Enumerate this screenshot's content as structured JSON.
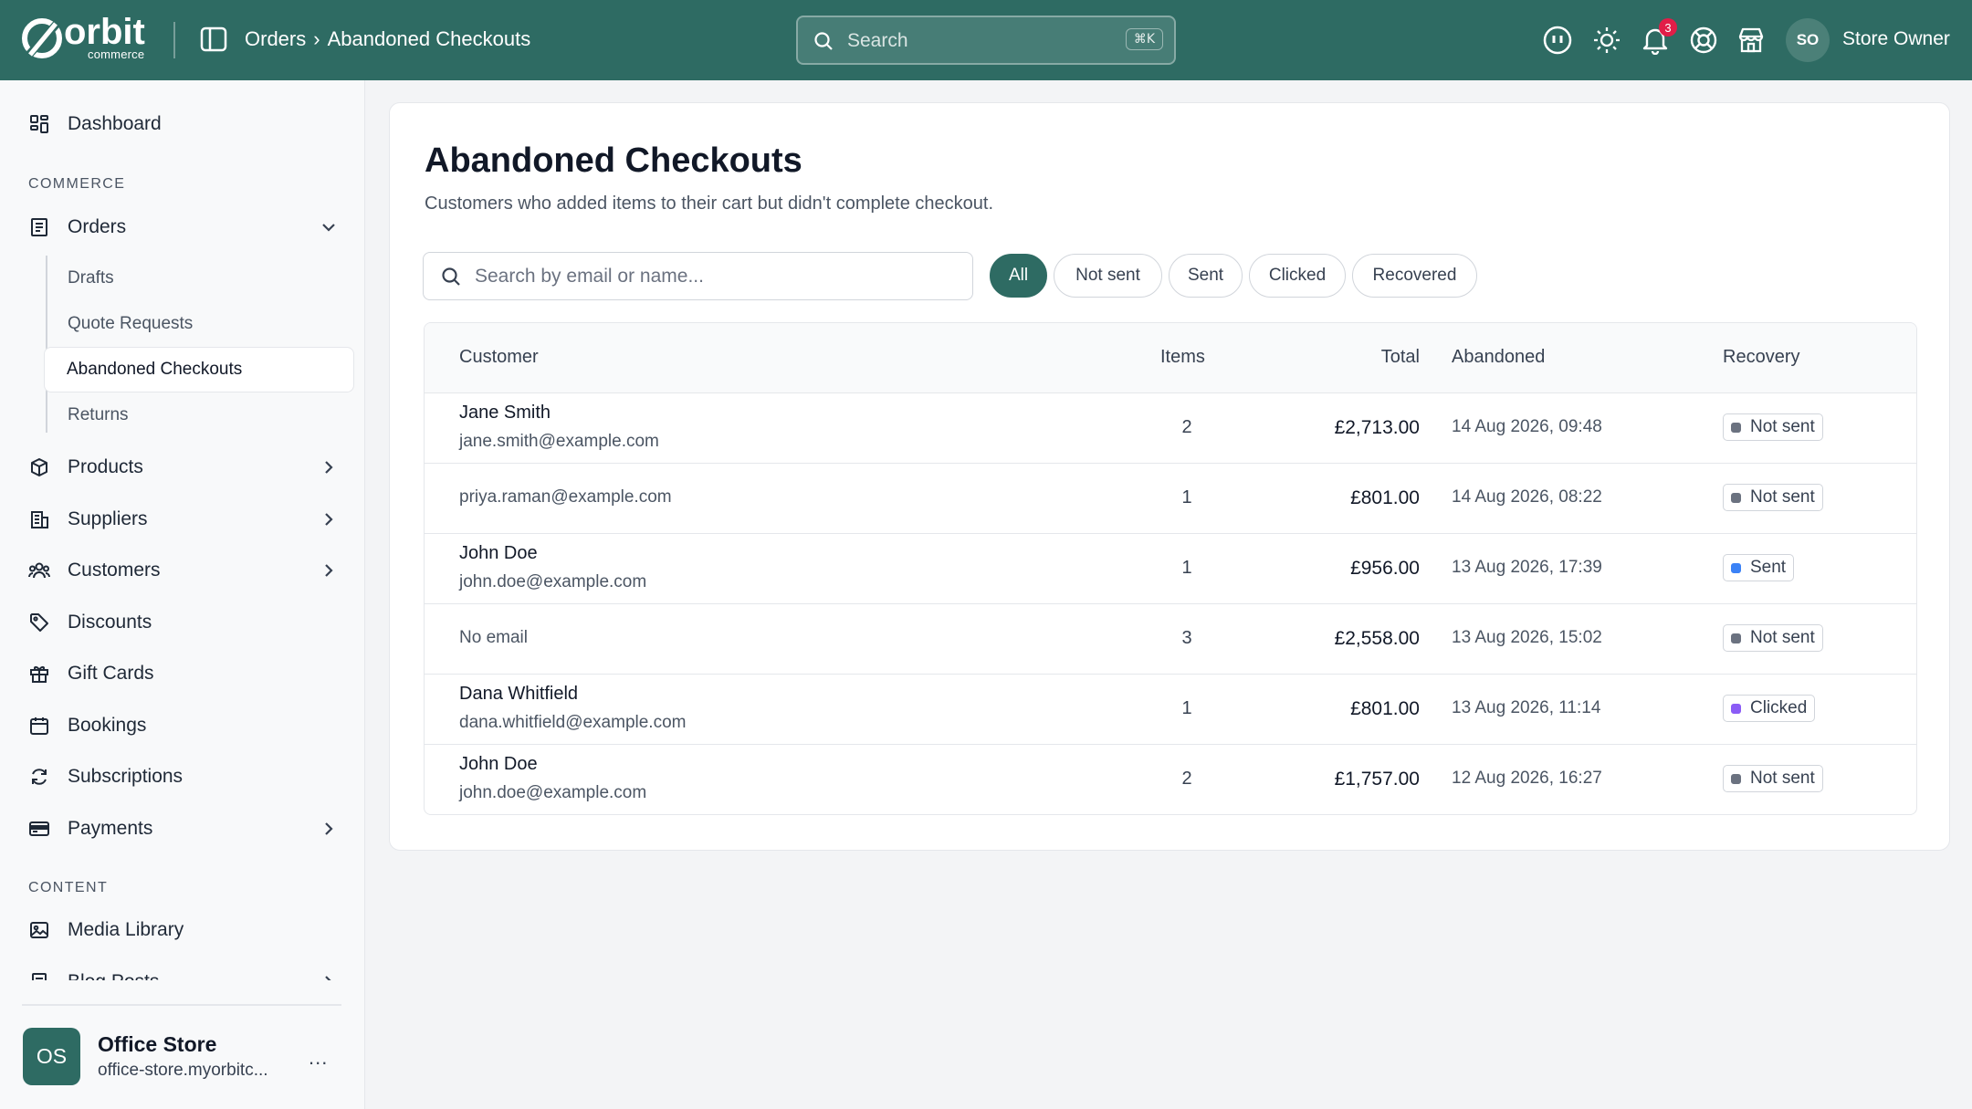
{
  "header": {
    "logo_text": "orbit",
    "logo_sub": "commerce",
    "breadcrumb": [
      "Orders",
      "›",
      "Abandoned Checkouts"
    ],
    "search_placeholder": "Search",
    "search_shortcut": "⌘K",
    "notification_count": "3",
    "avatar_initials": "SO",
    "user_name": "Store Owner"
  },
  "sidebar": {
    "dashboard": "Dashboard",
    "section_commerce": "COMMERCE",
    "orders": "Orders",
    "orders_sub": [
      "Drafts",
      "Quote Requests",
      "Abandoned Checkouts",
      "Returns"
    ],
    "products": "Products",
    "suppliers": "Suppliers",
    "customers": "Customers",
    "discounts": "Discounts",
    "gift_cards": "Gift Cards",
    "bookings": "Bookings",
    "subscriptions": "Subscriptions",
    "payments": "Payments",
    "section_content": "CONTENT",
    "media_library": "Media Library",
    "blog_posts": "Blog Posts",
    "store": {
      "initials": "OS",
      "name": "Office Store",
      "url": "office-store.myorbitc...",
      "more": "..."
    }
  },
  "main": {
    "title": "Abandoned Checkouts",
    "subtitle": "Customers who added items to their cart but didn't complete checkout.",
    "search_placeholder": "Search by email or name...",
    "filters": [
      "All",
      "Not sent",
      "Sent",
      "Clicked",
      "Recovered"
    ],
    "active_filter": "All",
    "columns": {
      "customer": "Customer",
      "items": "Items",
      "total": "Total",
      "abandoned": "Abandoned",
      "recovery": "Recovery"
    },
    "rows": [
      {
        "name": "Jane Smith",
        "email": "jane.smith@example.com",
        "items": "2",
        "total": "£2,713.00",
        "abandoned": "14 Aug 2026, 09:48",
        "recovery": "Not sent"
      },
      {
        "name": "",
        "email": "priya.raman@example.com",
        "items": "1",
        "total": "£801.00",
        "abandoned": "14 Aug 2026, 08:22",
        "recovery": "Not sent"
      },
      {
        "name": "John Doe",
        "email": "john.doe@example.com",
        "items": "1",
        "total": "£956.00",
        "abandoned": "13 Aug 2026, 17:39",
        "recovery": "Sent"
      },
      {
        "name": "",
        "email": "No email",
        "items": "3",
        "total": "£2,558.00",
        "abandoned": "13 Aug 2026, 15:02",
        "recovery": "Not sent"
      },
      {
        "name": "Dana Whitfield",
        "email": "dana.whitfield@example.com",
        "items": "1",
        "total": "£801.00",
        "abandoned": "13 Aug 2026, 11:14",
        "recovery": "Clicked"
      },
      {
        "name": "John Doe",
        "email": "john.doe@example.com",
        "items": "2",
        "total": "£1,757.00",
        "abandoned": "12 Aug 2026, 16:27",
        "recovery": "Not sent"
      }
    ]
  },
  "colors": {
    "brand": "#2e6b63",
    "status_not_sent": "#6b7280",
    "status_sent": "#3b82f6",
    "status_clicked": "#8b5cf6",
    "notification": "#e11d48"
  }
}
